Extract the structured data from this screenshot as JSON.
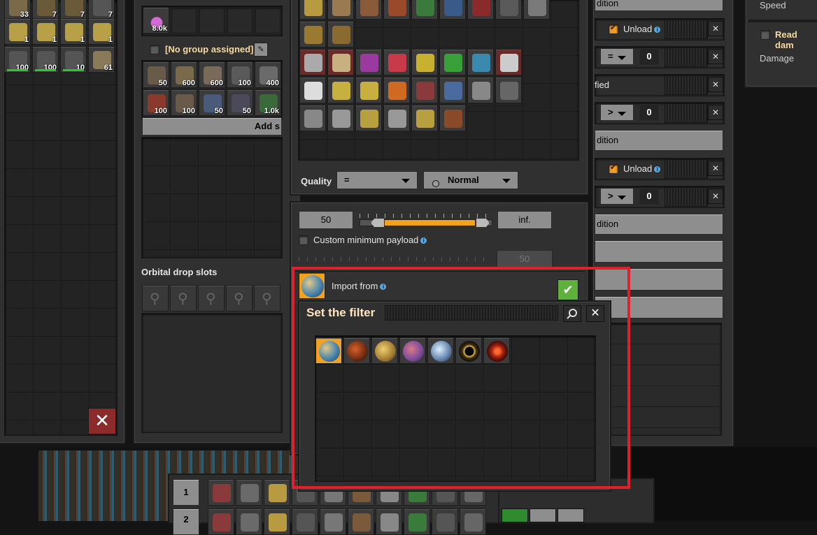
{
  "left_inventory": {
    "slot_counts": [
      "33",
      "7",
      "7",
      "7",
      "1",
      "1",
      "1",
      "1",
      "100",
      "100",
      "10",
      "61"
    ]
  },
  "logistics": {
    "science_count": "8.0k",
    "group_label": "[No group assigned]",
    "request_counts": [
      "50",
      "600",
      "600",
      "100",
      "400",
      "100",
      "100",
      "50",
      "50",
      "1.0k"
    ],
    "add_section_label": "Add s"
  },
  "orbital": {
    "title": "Orbital drop slots"
  },
  "filter_panel": {
    "quality_label": "Quality",
    "quality_comparator": "=",
    "quality_value": "Normal"
  },
  "payload": {
    "min_value": "50",
    "max_value": "inf.",
    "slider_fill_percent": 100,
    "custom_min_label": "Custom minimum payload",
    "disabled_value": "50"
  },
  "import_from": {
    "label": "Import from"
  },
  "set_filter": {
    "title": "Set the filter",
    "planets": [
      "nauvis",
      "vulcanus",
      "fulgora",
      "gleba",
      "aquilo",
      "shattered-planet",
      "solar-system-edge"
    ]
  },
  "conditions": {
    "header1": "dition",
    "unload1": "Unload",
    "cmp1": "=",
    "val1": "0",
    "specified": "fied",
    "cmp2": ">",
    "val2": "0",
    "header2": "dition",
    "unload2": "Unload",
    "cmp3": ">",
    "val3": "0",
    "header3": "dition"
  },
  "right_info": {
    "speed_label": "Speed",
    "read_damage_label": "Read dam",
    "damage_label": "Damage"
  },
  "toolbar": {
    "row1": "1",
    "row2": "2"
  },
  "colors": {
    "highlight": "#e0212b",
    "accent_orange": "#f29a22",
    "confirm_green": "#5eb23c"
  }
}
